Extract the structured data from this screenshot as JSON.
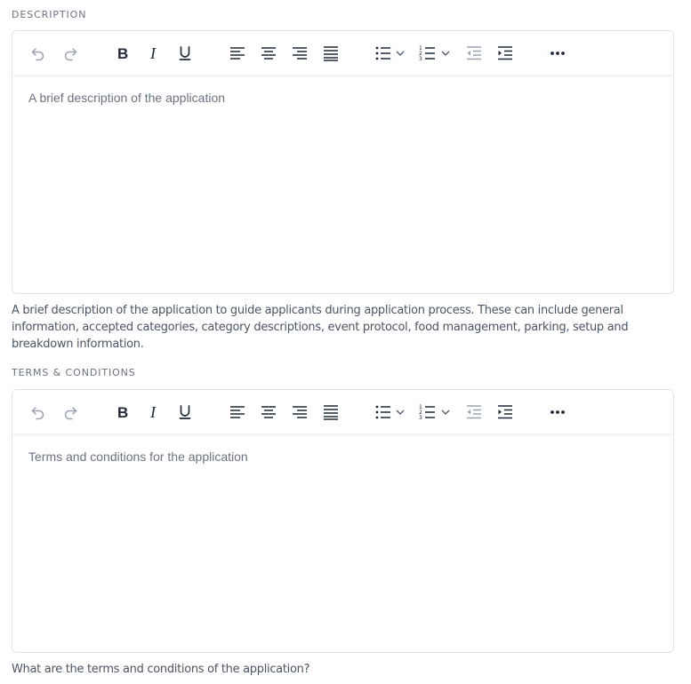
{
  "description": {
    "label": "DESCRIPTION",
    "placeholder": "A brief description of the application",
    "help": "A brief description of the application to guide applicants during application process. These can include general information, accepted categories, category descriptions, event protocol, food management, parking, setup and breakdown information."
  },
  "terms": {
    "label": "TERMS & CONDITIONS",
    "placeholder": "Terms and conditions for the application",
    "help": "What are the terms and conditions of the application?"
  },
  "toolbar_icons": [
    "undo-icon",
    "redo-icon",
    "bold-icon",
    "italic-icon",
    "underline-icon",
    "align-left-icon",
    "align-center-icon",
    "align-right-icon",
    "align-justify-icon",
    "bullet-list-icon",
    "chevron-down-icon",
    "numbered-list-icon",
    "chevron-down-icon",
    "outdent-icon",
    "indent-icon",
    "more-icon"
  ],
  "colors": {
    "icon": "#1f2937",
    "icon_muted": "#9ca3af",
    "border": "#dfe3e8"
  }
}
